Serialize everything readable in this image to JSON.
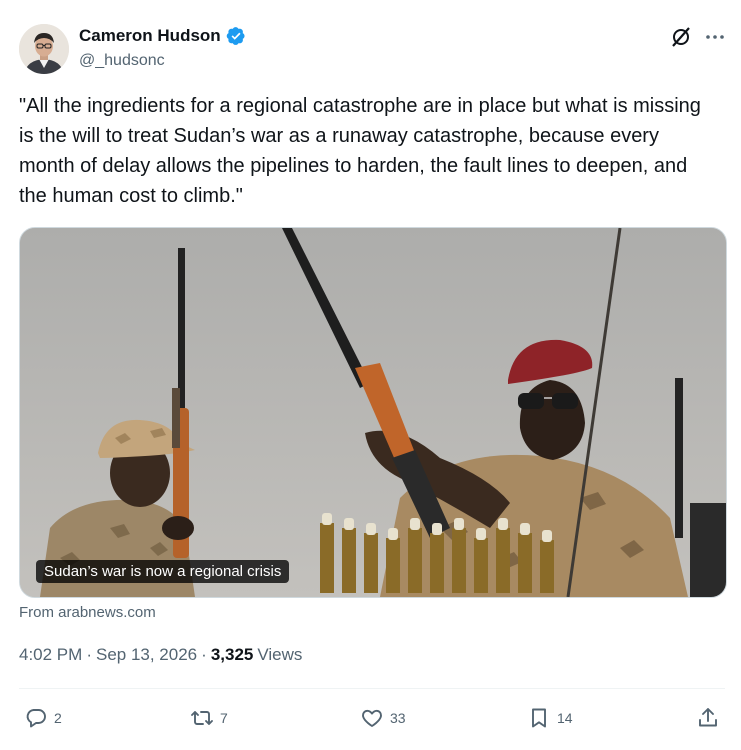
{
  "author": {
    "display_name": "Cameron Hudson",
    "handle": "@_hudsonc",
    "verified": true
  },
  "tweet": {
    "text": "\"All the ingredients for a regional catastrophe are in place but what is missing is the will to treat Sudan’s war as a runaway catastrophe, because every month of delay allows the pipelines to harden, the fault lines to deepen, and the human cost to climb.\""
  },
  "card": {
    "title": "Sudan’s war is now a regional crisis",
    "source": "From arabnews.com"
  },
  "meta": {
    "time": "4:02 PM",
    "separator1": "·",
    "date": "Sep 13, 2026",
    "separator2": "·",
    "views_count": "3,325",
    "views_label": "Views"
  },
  "actions": {
    "replies": "2",
    "reposts": "7",
    "likes": "33",
    "bookmarks": "14"
  },
  "colors": {
    "verified_blue": "#1d9bf0",
    "text_primary": "#0f1419",
    "text_secondary": "#536471"
  },
  "icons": {
    "verified": "verified-badge-icon",
    "grok": "grok-icon",
    "more": "more-dots-icon",
    "reply": "reply-icon",
    "repost": "repost-icon",
    "like": "heart-icon",
    "bookmark": "bookmark-icon",
    "share": "share-icon"
  }
}
